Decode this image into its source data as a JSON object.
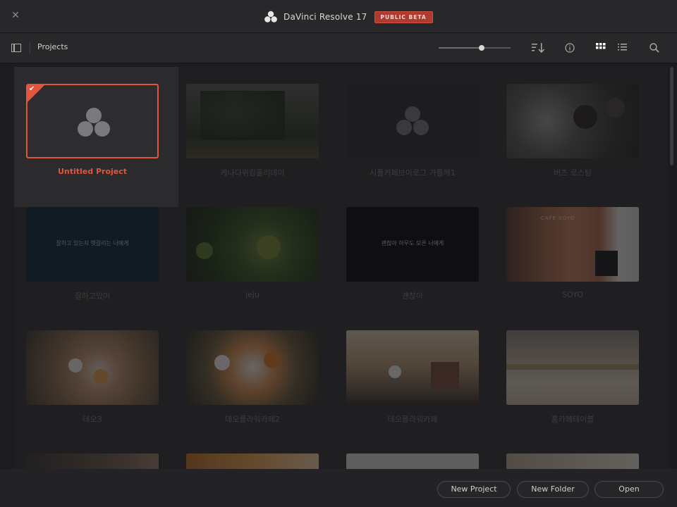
{
  "window": {
    "title": "DaVinci Resolve 17",
    "badge": "PUBLIC BETA",
    "close_icon": "close-icon"
  },
  "toolbar": {
    "breadcrumb": "Projects",
    "thumbnail_zoom": 0.6,
    "icons": [
      "sidebar-toggle-icon",
      "sort-icon",
      "info-icon",
      "grid-view-icon",
      "list-view-icon",
      "search-icon"
    ]
  },
  "projects": [
    {
      "label": "Untitled Project",
      "selected": true,
      "thumb": "resolve-logo"
    },
    {
      "label": "케나다위킹홀리데이",
      "selected": false,
      "thumb": "trees"
    },
    {
      "label": "시플카페브이로그 가틀헤1",
      "selected": false,
      "thumb": "resolve-logo"
    },
    {
      "label": "버즈 로스팅",
      "selected": false,
      "thumb": "machine"
    },
    {
      "label": "잘하고있어",
      "selected": false,
      "thumb": "text-dark-blue"
    },
    {
      "label": "jeju",
      "selected": false,
      "thumb": "oranges"
    },
    {
      "label": "괜찮아",
      "selected": false,
      "thumb": "text-black"
    },
    {
      "label": "SOYO",
      "selected": false,
      "thumb": "cafe-soyo"
    },
    {
      "label": "데오3",
      "selected": false,
      "thumb": "flowers-1"
    },
    {
      "label": "데오플라워카페2",
      "selected": false,
      "thumb": "flowers-2"
    },
    {
      "label": "데오플라워카페",
      "selected": false,
      "thumb": "cafe-interior"
    },
    {
      "label": "홈카페테이블",
      "selected": false,
      "thumb": "table"
    }
  ],
  "thumb_text": {
    "blue_caption": "잘하고 있는지 헷갈리는 너에게",
    "black_caption": "괜찮아 아무도 모른 너에게",
    "soyo_sign": "CAFE SOYO"
  },
  "footer": {
    "new_project": "New Project",
    "new_folder": "New Folder",
    "open": "Open"
  },
  "colors": {
    "accent": "#e2553f",
    "badge_bg": "#b03a2e",
    "background": "#1f1f21"
  }
}
